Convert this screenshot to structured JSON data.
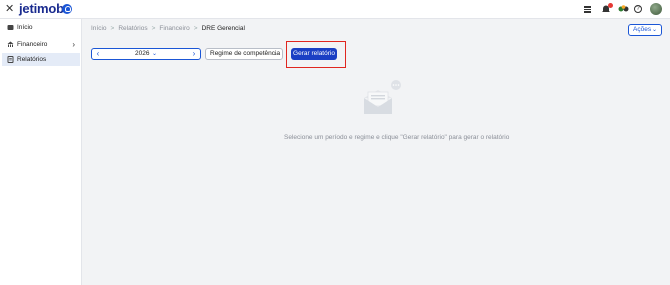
{
  "topbar": {
    "logo_text": "jetimob",
    "icons": [
      "close-icon",
      "grid-menu-icon",
      "notifications-icon",
      "apps-icon",
      "help-icon",
      "avatar"
    ]
  },
  "sidebar": {
    "items": [
      {
        "label": "Início",
        "icon": "home-icon"
      },
      {
        "label": "Financeiro",
        "icon": "finance-icon"
      },
      {
        "label": "Relatórios",
        "icon": "reports-icon"
      }
    ],
    "active": "Relatórios"
  },
  "breadcrumb": {
    "items": [
      "Início",
      "Relatórios",
      "Financeiro"
    ],
    "current": "DRE Gerencial",
    "separator": ">"
  },
  "header": {
    "actions_label": "Ações"
  },
  "filters": {
    "year": "2026",
    "regime_value": "Regime de competência",
    "generate_label": "Gerar relatório"
  },
  "empty_state": {
    "message": "Selecione um período e regime e clique \"Gerar relatório\" para gerar o relatório"
  },
  "colors": {
    "brand": "#1a2b8f",
    "accent": "#1b56d6",
    "primary_button": "#1b3fc4",
    "highlight": "#e0261f",
    "notification_dot": "#e53935"
  }
}
